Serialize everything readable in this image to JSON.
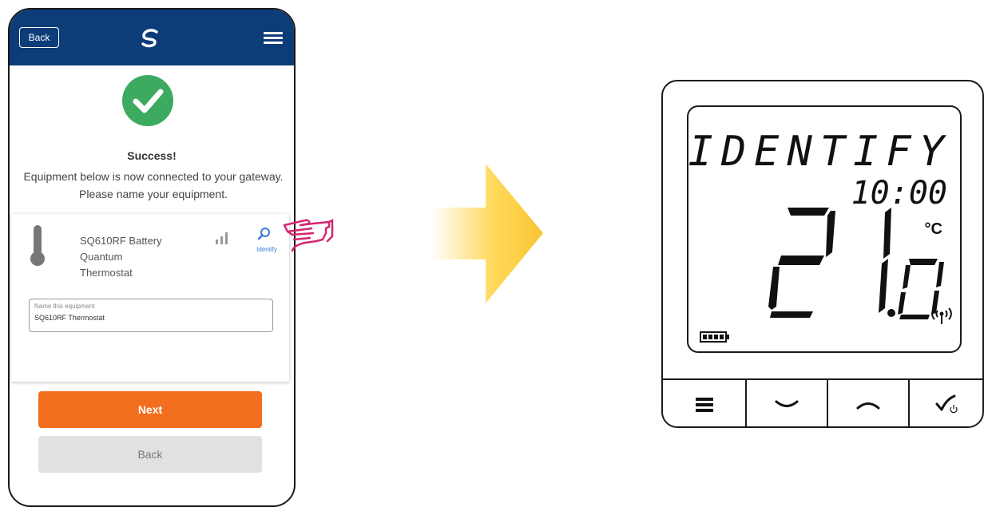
{
  "phone": {
    "header": {
      "back_label": "Back"
    },
    "success_title": "Success!",
    "description": "Equipment below is now connected to your gateway. Please name your equipment.",
    "device": {
      "name_line1": "SQ610RF Battery",
      "name_line2": "Quantum",
      "name_line3": "Thermostat",
      "identify_label": "Identify"
    },
    "name_field": {
      "label": "Name this equipment",
      "value": "SQ610RF Thermostat"
    },
    "next_label": "Next",
    "back_label": "Back",
    "colors": {
      "header": "#0c3d79",
      "success": "#3dab5f",
      "next": "#f26e1f"
    }
  },
  "thermostat": {
    "display_mode": "IDENTIFY",
    "time": "10:00",
    "temperature": "21.0",
    "unit": "°C",
    "battery_icon": "battery-full-icon",
    "wireless_icon": "wireless-signal-icon",
    "buttons": [
      {
        "icon": "menu-icon"
      },
      {
        "icon": "chevron-down-icon"
      },
      {
        "icon": "chevron-up-icon"
      },
      {
        "icon": "check-power-icon"
      }
    ]
  }
}
